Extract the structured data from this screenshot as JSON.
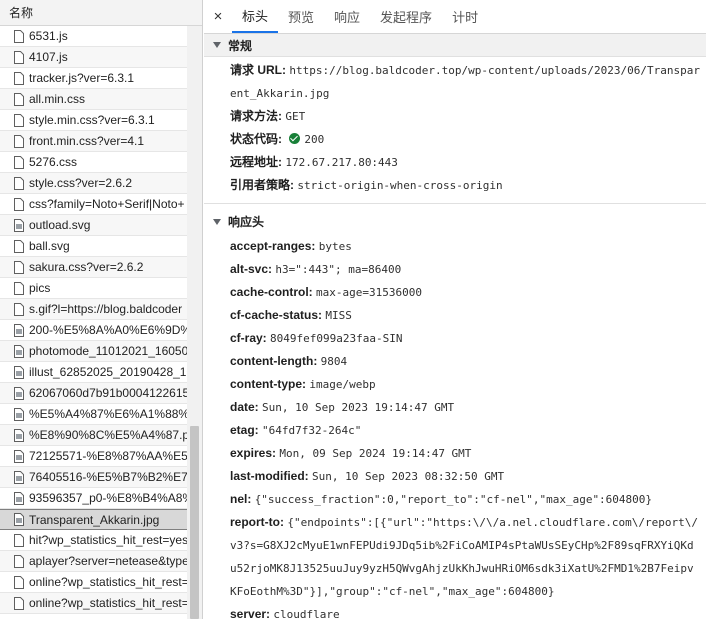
{
  "list": {
    "header": "名称",
    "items": [
      {
        "name": "6531.js",
        "icon": "file-icon"
      },
      {
        "name": "4107.js",
        "icon": "file-icon"
      },
      {
        "name": "tracker.js?ver=6.3.1",
        "icon": "file-icon"
      },
      {
        "name": "all.min.css",
        "icon": "file-icon"
      },
      {
        "name": "style.min.css?ver=6.3.1",
        "icon": "file-icon"
      },
      {
        "name": "front.min.css?ver=4.1",
        "icon": "file-icon"
      },
      {
        "name": "5276.css",
        "icon": "file-icon"
      },
      {
        "name": "style.css?ver=2.6.2",
        "icon": "file-icon"
      },
      {
        "name": "css?family=Noto+Serif|Noto+",
        "icon": "file-icon"
      },
      {
        "name": "outload.svg",
        "icon": "image-file-icon"
      },
      {
        "name": "ball.svg",
        "icon": "file-icon"
      },
      {
        "name": "sakura.css?ver=2.6.2",
        "icon": "file-icon"
      },
      {
        "name": "pics",
        "icon": "file-icon"
      },
      {
        "name": "s.gif?l=https://blog.baldcoder",
        "icon": "file-icon"
      },
      {
        "name": "200-%E5%8A%A0%E6%9D%8",
        "icon": "image-file-icon"
      },
      {
        "name": "photomode_11012021_16050",
        "icon": "image-file-icon"
      },
      {
        "name": "illust_62852025_20190428_10",
        "icon": "image-file-icon"
      },
      {
        "name": "62067060d7b91b0004122615",
        "icon": "image-file-icon"
      },
      {
        "name": "%E5%A4%87%E6%A1%88%E5",
        "icon": "image-file-icon"
      },
      {
        "name": "%E8%90%8C%E5%A4%87.png",
        "icon": "image-file-icon"
      },
      {
        "name": "72125571-%E8%87%AA%E5%",
        "icon": "image-file-icon"
      },
      {
        "name": "76405516-%E5%B7%B2%E7%",
        "icon": "image-file-icon"
      },
      {
        "name": "93596357_p0-%E8%B4%A8%E",
        "icon": "image-file-icon"
      },
      {
        "name": "Transparent_Akkarin.jpg",
        "icon": "image-file-icon",
        "selected": true
      },
      {
        "name": "hit?wp_statistics_hit_rest=yes.",
        "icon": "file-icon"
      },
      {
        "name": "aplayer?server=netease&type",
        "icon": "file-icon"
      },
      {
        "name": "online?wp_statistics_hit_rest=y",
        "icon": "file-icon"
      },
      {
        "name": "online?wp_statistics_hit_rest=y",
        "icon": "file-icon"
      }
    ]
  },
  "tabs": {
    "close": "×",
    "items": [
      "标头",
      "预览",
      "响应",
      "发起程序",
      "计时"
    ],
    "active_index": 0
  },
  "general": {
    "title": "常规",
    "request_url_label": "请求 URL:",
    "request_url": "https://blog.baldcoder.top/wp-content/uploads/2023/06/Transparent_Akkarin.jpg",
    "method_label": "请求方法:",
    "method": "GET",
    "status_label": "状态代码:",
    "status": "200",
    "status_color": "#188038",
    "remote_label": "远程地址:",
    "remote": "172.67.217.80:443",
    "referrer_label": "引用者策略:",
    "referrer": "strict-origin-when-cross-origin"
  },
  "response_headers": {
    "title": "响应头",
    "items": [
      {
        "k": "accept-ranges:",
        "v": "bytes"
      },
      {
        "k": "alt-svc:",
        "v": "h3=\":443\"; ma=86400"
      },
      {
        "k": "cache-control:",
        "v": "max-age=31536000"
      },
      {
        "k": "cf-cache-status:",
        "v": "MISS"
      },
      {
        "k": "cf-ray:",
        "v": "8049fef099a23faa-SIN"
      },
      {
        "k": "content-length:",
        "v": "9804"
      },
      {
        "k": "content-type:",
        "v": "image/webp"
      },
      {
        "k": "date:",
        "v": "Sun, 10 Sep 2023 19:14:47 GMT"
      },
      {
        "k": "etag:",
        "v": "\"64fd7f32-264c\""
      },
      {
        "k": "expires:",
        "v": "Mon, 09 Sep 2024 19:14:47 GMT"
      },
      {
        "k": "last-modified:",
        "v": "Sun, 10 Sep 2023 08:32:50 GMT"
      },
      {
        "k": "nel:",
        "v": "{\"success_fraction\":0,\"report_to\":\"cf-nel\",\"max_age\":604800}"
      },
      {
        "k": "report-to:",
        "v": "{\"endpoints\":[{\"url\":\"https:\\/\\/a.nel.cloudflare.com\\/report\\/v3?s=G8XJ2cMyuE1wnFEPUdi9JDq5ib%2FiCoAMIP4sPtaWUsSEyCHp%2F89sqFRXYiQKdu52rjoMK8J13525uuJuy9yzH5QWvgAhjzUkKhJwuHRiOM6sdk3iXatU%2FMD1%2B7FeipvKFoEothM%3D\"}],\"group\":\"cf-nel\",\"max_age\":604800}"
      },
      {
        "k": "server:",
        "v": "cloudflare"
      },
      {
        "k": "vary:",
        "v": "Accept, Accept-Encoding"
      }
    ]
  }
}
